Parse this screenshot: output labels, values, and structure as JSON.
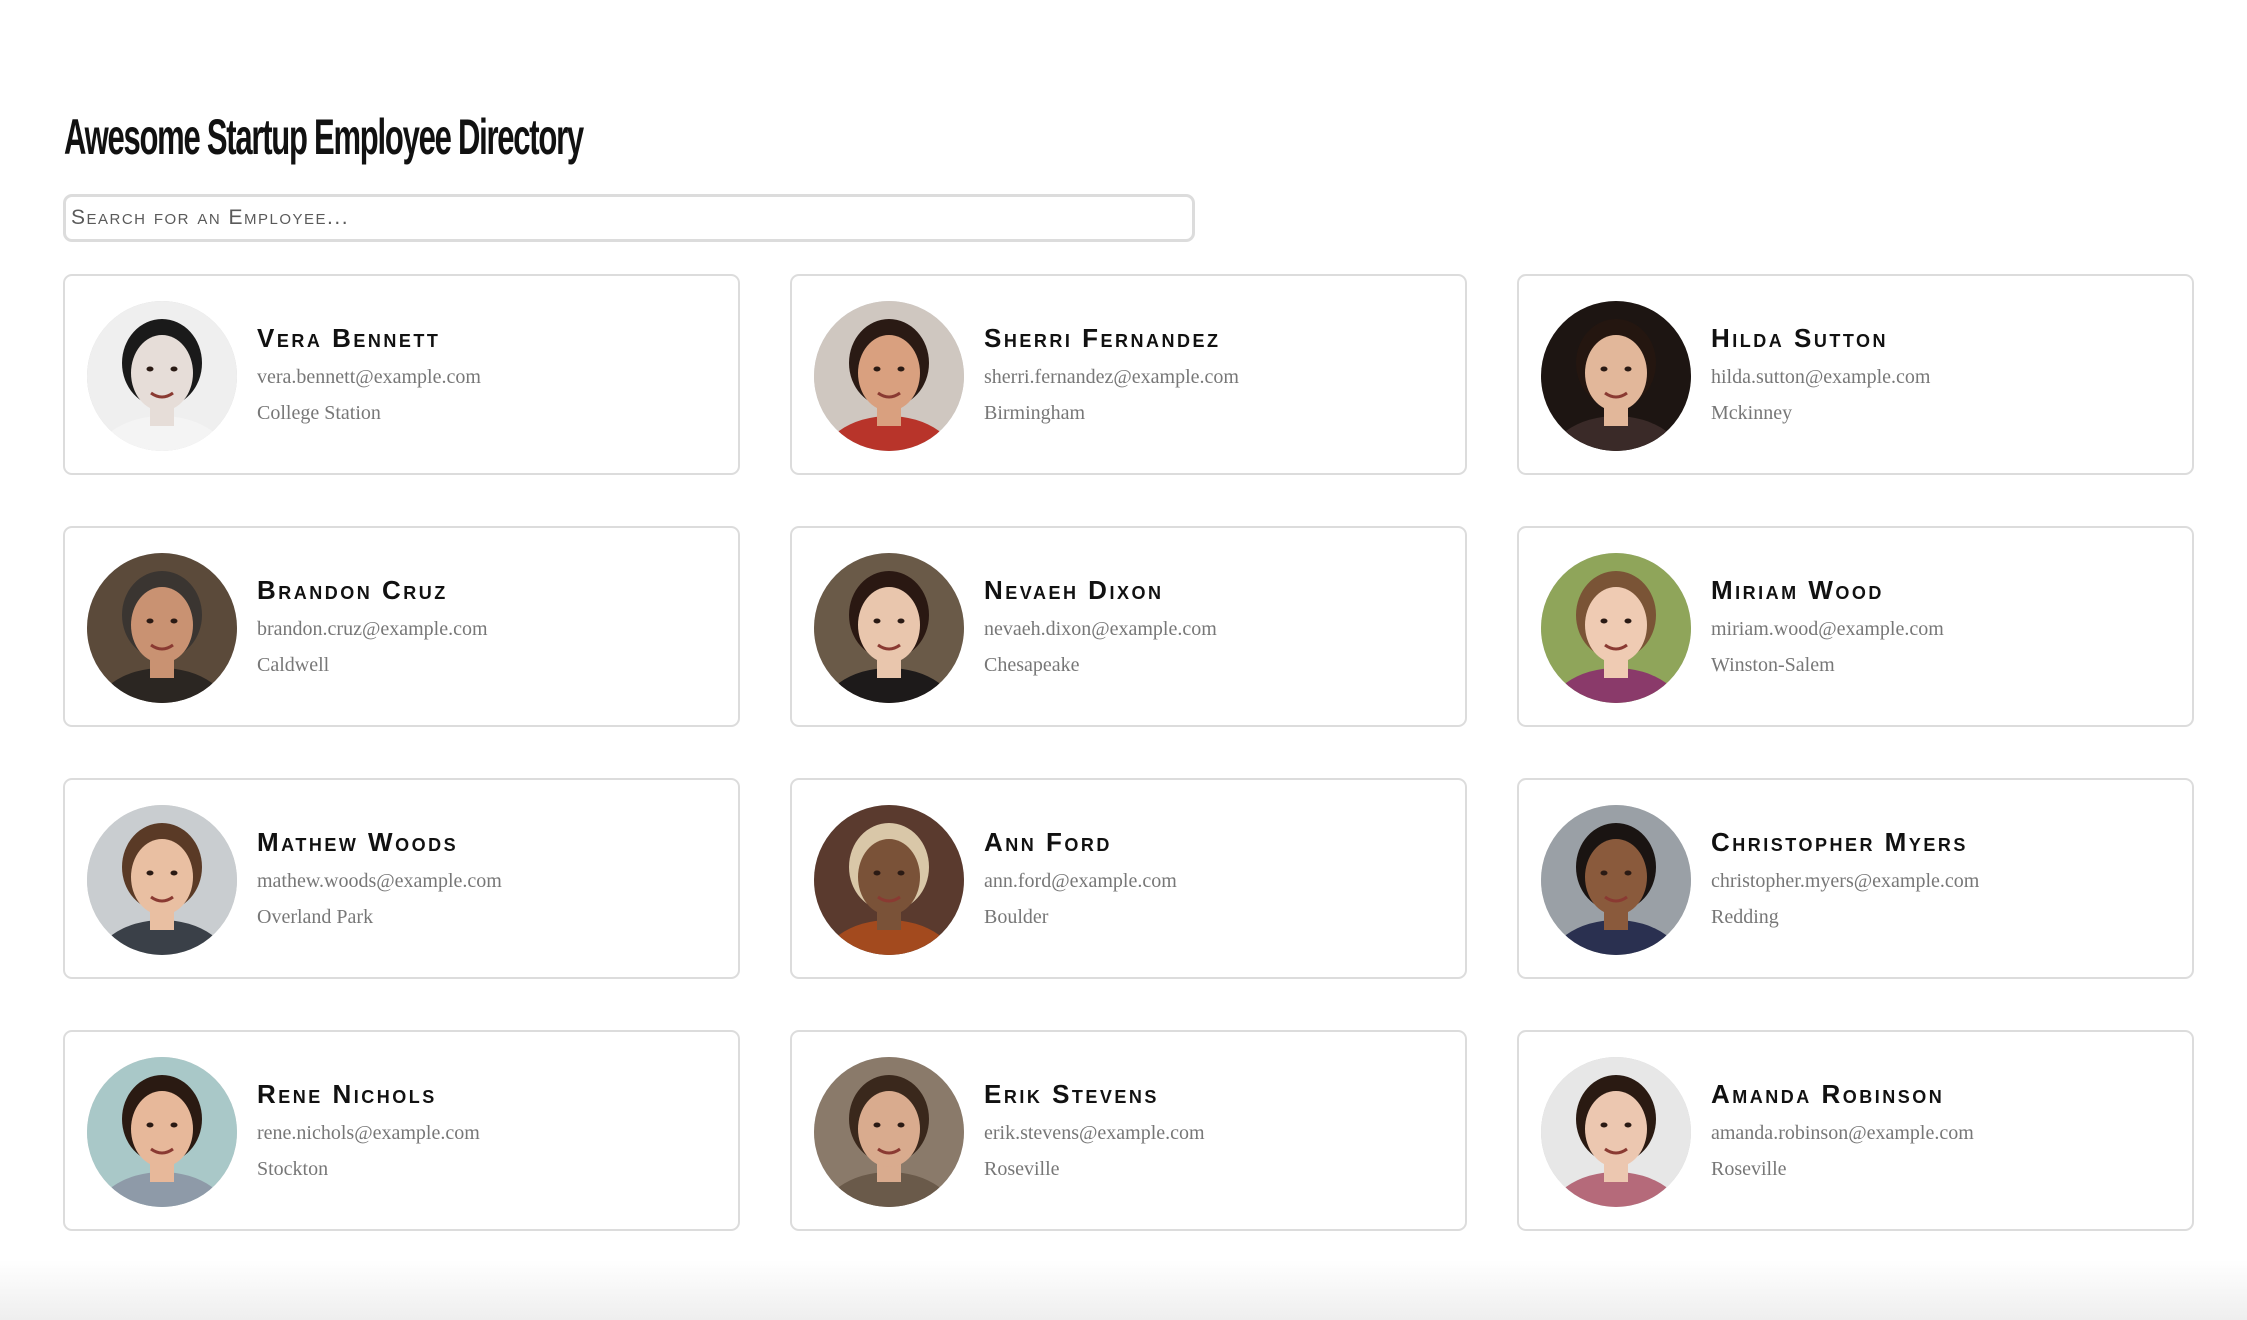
{
  "header": {
    "title": "Awesome Startup Employee Directory"
  },
  "search": {
    "placeholder": "Search for an Employee..."
  },
  "employees": [
    {
      "name": "Vera Bennett",
      "email": "vera.bennett@example.com",
      "city": "College Station",
      "bg": "#efefef",
      "skin": "#e6ddd8",
      "hair": "#1a1a1a",
      "shirt": "#f4f4f4"
    },
    {
      "name": "Sherri Fernandez",
      "email": "sherri.fernandez@example.com",
      "city": "Birmingham",
      "bg": "#cfc7c0",
      "skin": "#d9a07f",
      "hair": "#2a1a14",
      "shirt": "#b8342a"
    },
    {
      "name": "Hilda Sutton",
      "email": "hilda.sutton@example.com",
      "city": "Mckinney",
      "bg": "#1d1512",
      "skin": "#e2b79a",
      "hair": "#241610",
      "shirt": "#3a2a28"
    },
    {
      "name": "Brandon Cruz",
      "email": "brandon.cruz@example.com",
      "city": "Caldwell",
      "bg": "#5b4a3a",
      "skin": "#c99272",
      "hair": "#3a3531",
      "shirt": "#2b2622"
    },
    {
      "name": "Nevaeh Dixon",
      "email": "nevaeh.dixon@example.com",
      "city": "Chesapeake",
      "bg": "#6a5a48",
      "skin": "#e9c6ad",
      "hair": "#2a1812",
      "shirt": "#1d1a1a"
    },
    {
      "name": "Miriam Wood",
      "email": "miriam.wood@example.com",
      "city": "Winston-Salem",
      "bg": "#8fa55a",
      "skin": "#efcbb3",
      "hair": "#7a5436",
      "shirt": "#8a3a6a"
    },
    {
      "name": "Mathew Woods",
      "email": "mathew.woods@example.com",
      "city": "Overland Park",
      "bg": "#c9cdd0",
      "skin": "#e9bfa2",
      "hair": "#5a3a26",
      "shirt": "#3a4048"
    },
    {
      "name": "Ann Ford",
      "email": "ann.ford@example.com",
      "city": "Boulder",
      "bg": "#5a3a2e",
      "skin": "#7a5238",
      "hair": "#d9c7a8",
      "shirt": "#a34a1e"
    },
    {
      "name": "Christopher Myers",
      "email": "christopher.myers@example.com",
      "city": "Redding",
      "bg": "#9aa0a6",
      "skin": "#8a5a3c",
      "hair": "#1a1412",
      "shirt": "#2a3050"
    },
    {
      "name": "Rene Nichols",
      "email": "rene.nichols@example.com",
      "city": "Stockton",
      "bg": "#a9c8c8",
      "skin": "#e7b89a",
      "hair": "#2a1a12",
      "shirt": "#8e9aa8"
    },
    {
      "name": "Erik Stevens",
      "email": "erik.stevens@example.com",
      "city": "Roseville",
      "bg": "#8a7a6a",
      "skin": "#d9ab8e",
      "hair": "#3a281c",
      "shirt": "#6a5a4a"
    },
    {
      "name": "Amanda Robinson",
      "email": "amanda.robinson@example.com",
      "city": "Roseville",
      "bg": "#e7e7e7",
      "skin": "#ecc7b0",
      "hair": "#2a1a12",
      "shirt": "#b56a7a"
    }
  ]
}
